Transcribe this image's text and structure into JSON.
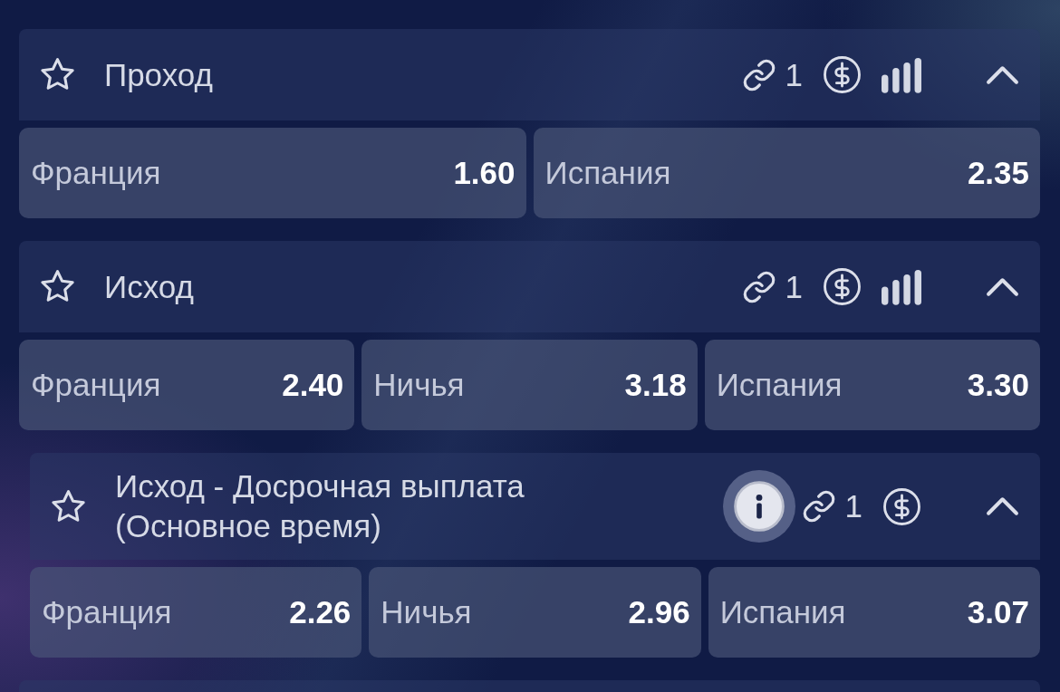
{
  "markets": [
    {
      "title": "Проход",
      "favorite": false,
      "info": false,
      "links": "1",
      "cashout": true,
      "stats": true,
      "expanded": true,
      "outcomes": [
        {
          "label": "Франция",
          "odds": "1.60"
        },
        {
          "label": "Испания",
          "odds": "2.35"
        }
      ]
    },
    {
      "title": "Исход",
      "favorite": false,
      "info": false,
      "links": "1",
      "cashout": true,
      "stats": true,
      "expanded": true,
      "outcomes": [
        {
          "label": "Франция",
          "odds": "2.40"
        },
        {
          "label": "Ничья",
          "odds": "3.18"
        },
        {
          "label": "Испания",
          "odds": "3.30"
        }
      ]
    },
    {
      "title": "Исход - Досрочная выплата (Основное время)",
      "favorite": false,
      "info": true,
      "links": "1",
      "cashout": true,
      "stats": false,
      "expanded": true,
      "outcomes": [
        {
          "label": "Франция",
          "odds": "2.26"
        },
        {
          "label": "Ничья",
          "odds": "2.96"
        },
        {
          "label": "Испания",
          "odds": "3.07"
        }
      ]
    }
  ]
}
